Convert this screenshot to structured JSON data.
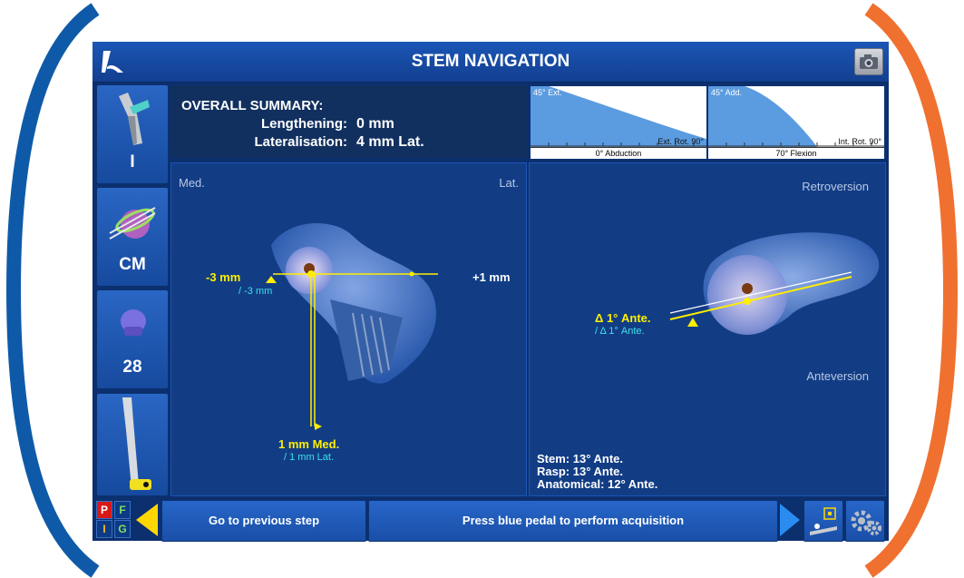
{
  "window": {
    "title": "STEM NAVIGATION"
  },
  "colors": {
    "accent_blue": "#0f5aa8",
    "accent_orange": "#f07030",
    "highlight_yellow": "#ffee00",
    "secondary_cyan": "#3ee0e8"
  },
  "sidebar": {
    "items": [
      {
        "label": "I",
        "icon": "stem-neck-icon"
      },
      {
        "label": "CM",
        "icon": "cup-icon"
      },
      {
        "label": "28",
        "icon": "head-ball-icon"
      },
      {
        "label": "",
        "icon": "stem-icon"
      }
    ]
  },
  "summary": {
    "title": "OVERALL SUMMARY:",
    "rows": [
      {
        "label": "Lengthening:",
        "value": "0 mm"
      },
      {
        "label": "Lateralisation:",
        "value": "4 mm Lat."
      }
    ]
  },
  "gauges": [
    {
      "top_label": "45° Ext.",
      "bottom_label": "Ext. Rot. 90°",
      "caption": "0° Abduction"
    },
    {
      "top_label": "45° Add.",
      "bottom_label": "Int. Rot. 90°",
      "caption": "70° Flexion"
    }
  ],
  "left_view": {
    "med_label": "Med.",
    "lat_label": "Lat.",
    "left_value": "-3 mm",
    "left_sub": "/ -3 mm",
    "right_value": "+1 mm",
    "bottom_value": "1 mm Med.",
    "bottom_sub": "/ 1 mm Lat."
  },
  "right_view": {
    "top_label": "Retroversion",
    "bottom_label": "Anteversion",
    "angle_value": "Δ 1° Ante.",
    "angle_sub": "/ Δ 1° Ante.",
    "info": [
      "Stem: 13° Ante.",
      "Rasp: 13° Ante.",
      "Anatomical: 12° Ante."
    ]
  },
  "footer": {
    "pfig": [
      "P",
      "F",
      "I",
      "G"
    ],
    "prev_label": "Go to previous step",
    "acquire_label": "Press blue pedal to perform acquisition"
  }
}
